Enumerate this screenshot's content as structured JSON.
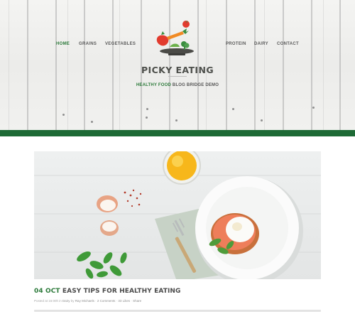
{
  "nav": {
    "left": [
      "HOME",
      "GRAINS",
      "VEGETABLES"
    ],
    "right": [
      "PROTEIN",
      "DAIRY",
      "CONTACT"
    ]
  },
  "brand": {
    "title": "PICKY EATING",
    "tagline_green": "HEALTHY FOOD",
    "tagline_rest": " BLOG BRIDGE DEMO"
  },
  "post": {
    "date": "04 OCT",
    "title": "EASY TIPS FOR HEALTHY EATING",
    "meta_prefix": "Posted at 16:00h in ",
    "category": "Dairy",
    "by": " by ",
    "author": "Ray Michaels",
    "sep1": " · ",
    "comments": "2 Comments",
    "sep2": " · ",
    "likes": "33 Likes",
    "sep3": " · ",
    "share": "Share"
  },
  "colors": {
    "accent": "#2c7a3a",
    "bar": "#1e6a35",
    "text": "#4a4a4a"
  }
}
